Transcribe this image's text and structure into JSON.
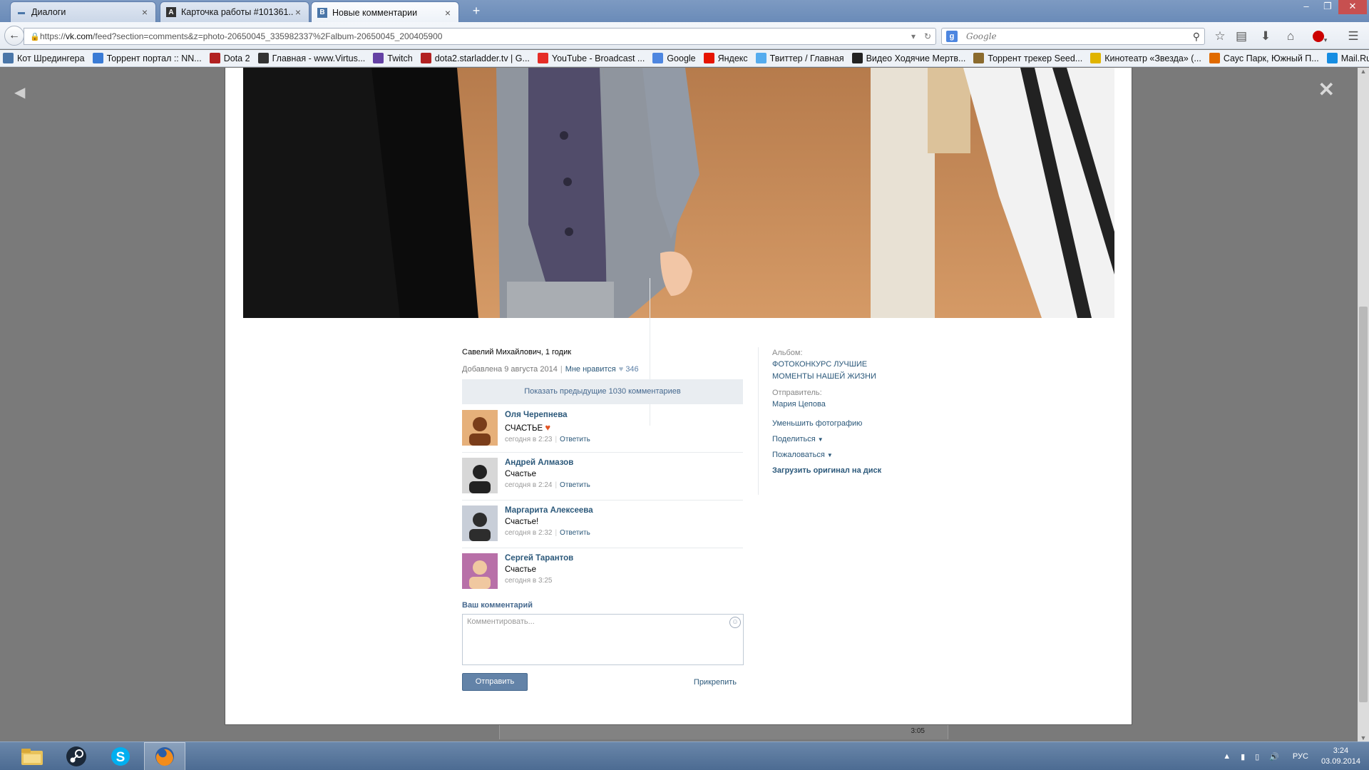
{
  "tabs": [
    {
      "title": "Диалоги",
      "icon": "vk-chat-icon",
      "active": false
    },
    {
      "title": "Карточка работы #101361...",
      "icon": "letter-a-icon",
      "active": false
    },
    {
      "title": "Новые комментарии",
      "icon": "vk-icon",
      "active": true
    }
  ],
  "navbar": {
    "url_prefix": "https://",
    "url_host": "vk.com",
    "url_path": "/feed?section=comments&z=photo-20650045_335982337%2Falbum-20650045_200405900",
    "search_placeholder": "Google"
  },
  "bookmarks": [
    {
      "label": "Кот Шредингера",
      "icon": "vk-icon",
      "color": "#4a76a8"
    },
    {
      "label": "Торрент портал :: NN...",
      "icon": "butterfly-icon",
      "color": "#3a7bd5"
    },
    {
      "label": "Dota 2",
      "icon": "dota-icon",
      "color": "#b22222"
    },
    {
      "label": "Главная - www.Virtus...",
      "icon": "virtus-icon",
      "color": "#333333"
    },
    {
      "label": "Twitch",
      "icon": "twitch-icon",
      "color": "#6441a4"
    },
    {
      "label": "dota2.starladder.tv | G...",
      "icon": "dota-icon",
      "color": "#b22222"
    },
    {
      "label": "YouTube - Broadcast ...",
      "icon": "youtube-icon",
      "color": "#e52d27"
    },
    {
      "label": "Google",
      "icon": "google-icon",
      "color": "#4d86e0"
    },
    {
      "label": "Яндекс",
      "icon": "yandex-icon",
      "color": "#e61400"
    },
    {
      "label": "Твиттер / Главная",
      "icon": "twitter-icon",
      "color": "#55acee"
    },
    {
      "label": "Видео Ходячие Мертв...",
      "icon": "walking-dead-icon",
      "color": "#222222"
    },
    {
      "label": "Торрент трекер Seed...",
      "icon": "seed-icon",
      "color": "#8b6b2e"
    },
    {
      "label": "Кинотеатр «Звезда» (...",
      "icon": "star-icon",
      "color": "#e0b400"
    },
    {
      "label": "Саус Парк, Южный П...",
      "icon": "south-park-icon",
      "color": "#e06a00"
    },
    {
      "label": "Mail.Ru: почта, поиск ...",
      "icon": "mailru-icon",
      "color": "#168de2"
    }
  ],
  "photo_info": {
    "title": "Савелий Михайлович, 1 годик",
    "added": "Добавлена 9 августа 2014",
    "like_label": "Мне нравится",
    "like_count": "346"
  },
  "comments_section": {
    "show_previous": "Показать предыдущие 1030 комментариев",
    "reply_label": "Ответить",
    "items": [
      {
        "author": "Оля Черепнева",
        "text": "СЧАСТЬЕ",
        "has_heart": true,
        "time": "сегодня в 2:23",
        "can_reply": true
      },
      {
        "author": "Андрей Алмазов",
        "text": "Счастье",
        "has_heart": false,
        "time": "сегодня в 2:24",
        "can_reply": true
      },
      {
        "author": "Маргарита Алексеева",
        "text": "Счастье!",
        "has_heart": false,
        "time": "сегодня в 2:32",
        "can_reply": true
      },
      {
        "author": "Сергей Тарантов",
        "text": "Счастье",
        "has_heart": false,
        "time": "сегодня в 3:25",
        "can_reply": false
      }
    ],
    "your_comment_label": "Ваш комментарий",
    "input_placeholder": "Комментировать...",
    "send_label": "Отправить",
    "attach_label": "Прикрепить"
  },
  "sidebar": {
    "album_label": "Альбом:",
    "album_name": "ФОТОКОНКУРС ЛУЧШИЕ МОМЕНТЫ НАШЕЙ ЖИЗНИ",
    "sender_label": "Отправитель:",
    "sender_name": "Мария Цепова",
    "shrink_label": "Уменьшить фотографию",
    "share_label": "Поделиться",
    "report_label": "Пожаловаться",
    "download_label": "Загрузить оригинал на диск"
  },
  "background_timestamp": "3:05",
  "taskbar": {
    "apps": [
      "explorer-icon",
      "steam-icon",
      "skype-icon",
      "firefox-icon"
    ],
    "lang": "РУС",
    "time": "3:24",
    "date": "03.09.2014"
  },
  "colors": {
    "vk_link": "#2b587a",
    "vk_button": "#6383a8",
    "heart": "#e25424"
  }
}
